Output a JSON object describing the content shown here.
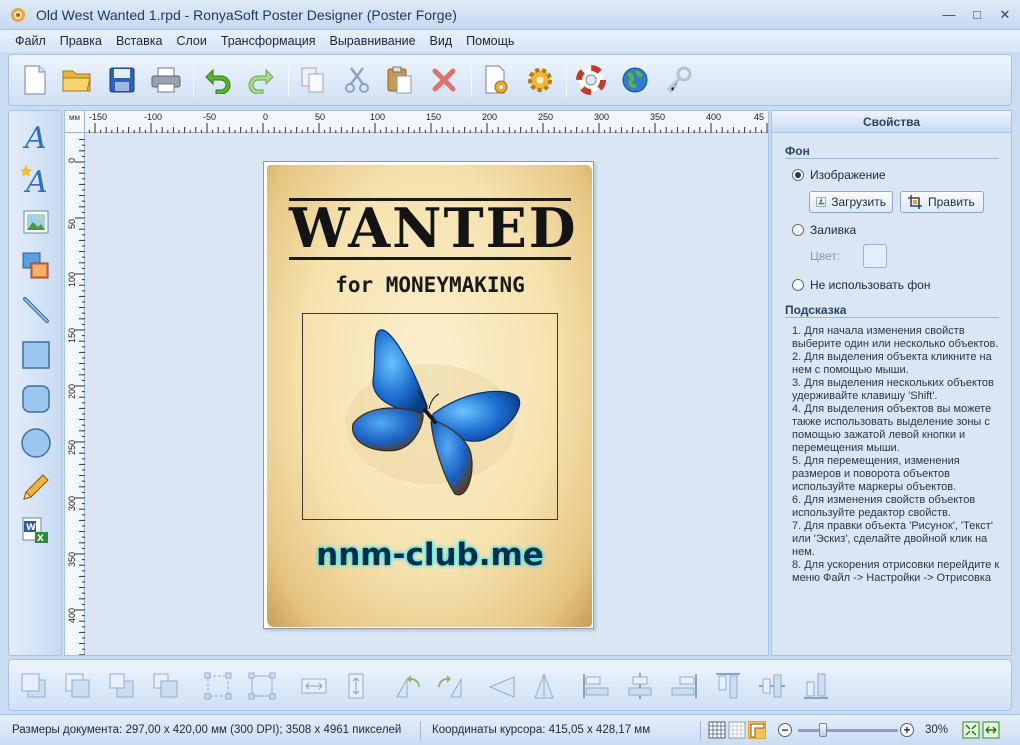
{
  "window": {
    "title": "Old West Wanted 1.rpd - RonyaSoft Poster Designer (Poster Forge)",
    "minimize": "—",
    "maximize": "□",
    "close": "✕"
  },
  "menu": {
    "items": [
      "Файл",
      "Правка",
      "Вставка",
      "Слои",
      "Трансформация",
      "Выравнивание",
      "Вид",
      "Помощь"
    ]
  },
  "toolbar": {
    "icons": [
      "new-document-icon",
      "open-folder-icon",
      "save-icon",
      "print-icon",
      "undo-icon",
      "redo-icon",
      "copy-icon",
      "cut-icon",
      "paste-icon",
      "delete-icon",
      "page-settings-icon",
      "settings-gear-icon",
      "help-lifebuoy-icon",
      "web-globe-icon",
      "register-key-icon"
    ]
  },
  "ruler": {
    "unit": "мм",
    "h_labels": [
      "-150",
      "-100",
      "-50",
      "0",
      "50",
      "100",
      "150",
      "200",
      "250",
      "300",
      "350",
      "400",
      "45"
    ],
    "v_labels": [
      "0",
      "50",
      "100",
      "150",
      "200",
      "250",
      "300",
      "350",
      "400"
    ]
  },
  "poster": {
    "headline": "WANTED",
    "subtitle": "for MONEYMAKING",
    "watermark": "nnm-club.me"
  },
  "properties": {
    "header": "Свойства",
    "background_section": "Фон",
    "option_image": "Изображение",
    "load_button": "Загрузить",
    "edit_button": "Править",
    "option_fill": "Заливка",
    "color_label": "Цвет:",
    "option_none": "Не использовать фон",
    "hint_section": "Подсказка",
    "hints": [
      "1. Для начала изменения свойств выберите один или несколько объектов.",
      "2. Для выделения объекта кликните на нем с помощью мыши.",
      "3. Для выделения нескольких объектов удерживайте клавишу 'Shift'.",
      "4. Для выделения объектов вы можете также использовать выделение зоны с помощью зажатой левой кнопки и перемещения мыши.",
      "5. Для перемещения, изменения размеров и поворота объектов используйте маркеры объектов.",
      "6. Для изменения свойств объектов используйте редактор свойств.",
      "7. Для правки объекта 'Рисунок', 'Текст' или 'Эскиз', сделайте двойной клик на нем.",
      "8. Для ускорения отрисовки перейдите к меню Файл -> Настройки -> Отрисовка"
    ]
  },
  "status": {
    "doc_size": "Размеры документа: 297,00 x 420,00 мм (300 DPI); 3508 x 4961 пикселей",
    "cursor": "Координаты курсора: 415,05 x 428,17 мм",
    "zoom": "30%",
    "zoom_minus": "−",
    "zoom_plus": "+",
    "zoom_slider_fraction": 0.25
  },
  "colors": {
    "chrome_bg": "#c9dcf2",
    "panel_bg": "#dbe6f4",
    "parchment": "#f5e2ae",
    "watermark_glow": "#3ff0ff"
  }
}
